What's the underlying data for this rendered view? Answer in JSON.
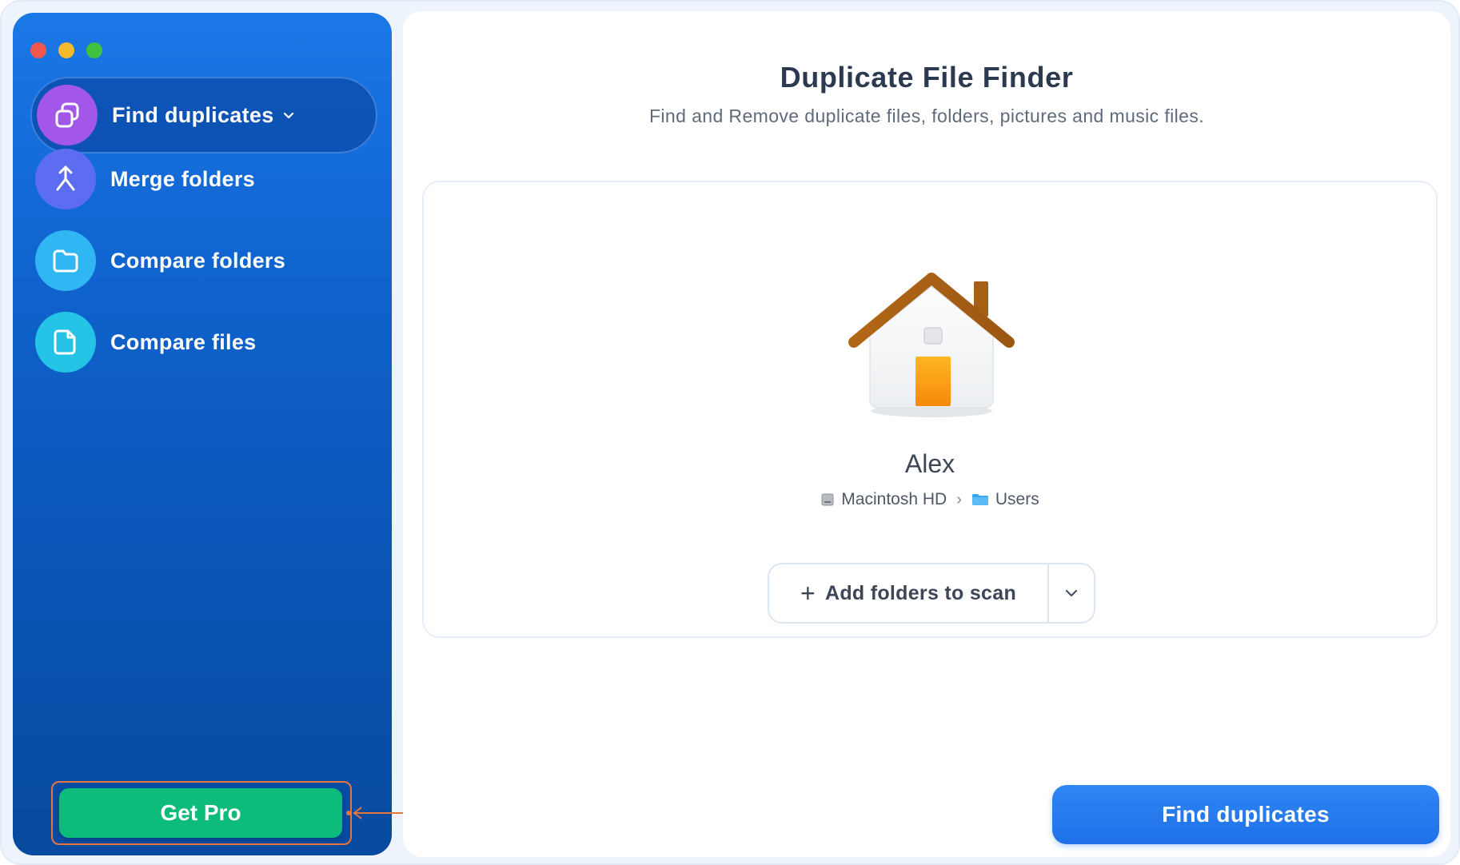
{
  "window": {
    "traffic_lights": [
      "close",
      "minimize",
      "zoom"
    ]
  },
  "sidebar": {
    "items": [
      {
        "label": "Find duplicates",
        "icon": "duplicate-squares-icon",
        "color": "#a257e8",
        "active": true,
        "has_dropdown": true
      },
      {
        "label": "Merge folders",
        "icon": "merge-arrow-icon",
        "color": "#5c6df2",
        "active": false
      },
      {
        "label": "Compare folders",
        "icon": "folder-icon",
        "color": "#30b6f2",
        "active": false
      },
      {
        "label": "Compare files",
        "icon": "file-icon",
        "color": "#25c3e6",
        "active": false
      }
    ],
    "get_pro_label": "Get Pro"
  },
  "main": {
    "title": "Duplicate File Finder",
    "subtitle": "Find and Remove duplicate files, folders, pictures and music files.",
    "folder": {
      "name": "Alex",
      "path": [
        "Macintosh HD",
        "Users"
      ]
    },
    "add_folders_label": "Add folders to scan",
    "find_button_label": "Find duplicates"
  },
  "colors": {
    "sidebar_gradient_top": "#1a78e6",
    "sidebar_gradient_bottom": "#074a9f",
    "accent_blue": "#1f70e8",
    "get_pro_green": "#0dbb7a",
    "highlight_orange": "#e9743d"
  }
}
